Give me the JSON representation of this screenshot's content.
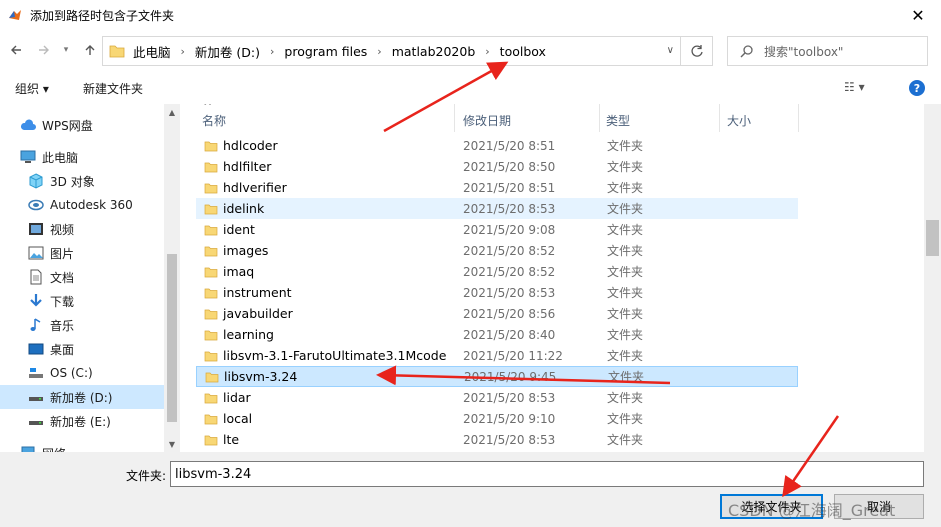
{
  "window": {
    "title": "添加到路径时包含子文件夹",
    "close": "✕"
  },
  "nav": {
    "breadcrumbs": [
      "此电脑",
      "新加卷 (D:)",
      "program files",
      "matlab2020b",
      "toolbox"
    ],
    "search_placeholder": "搜索\"toolbox\""
  },
  "toolbar": {
    "organize": "组织 ▾",
    "new_folder": "新建文件夹",
    "view": "☷ ▾",
    "help": "?"
  },
  "sidebar": {
    "items": [
      {
        "label": "WPS网盘",
        "icon": "cloud-icon"
      },
      {
        "label": "此电脑",
        "icon": "computer-icon"
      },
      {
        "label": "3D 对象",
        "icon": "3d-objects-icon"
      },
      {
        "label": "Autodesk 360",
        "icon": "autodesk-icon"
      },
      {
        "label": "视频",
        "icon": "video-icon"
      },
      {
        "label": "图片",
        "icon": "pictures-icon"
      },
      {
        "label": "文档",
        "icon": "documents-icon"
      },
      {
        "label": "下载",
        "icon": "download-icon"
      },
      {
        "label": "音乐",
        "icon": "music-icon"
      },
      {
        "label": "桌面",
        "icon": "desktop-icon"
      },
      {
        "label": "OS (C:)",
        "icon": "drive-icon"
      },
      {
        "label": "新加卷 (D:)",
        "icon": "drive-icon",
        "selected": true
      },
      {
        "label": "新加卷 (E:)",
        "icon": "drive-icon"
      },
      {
        "label": "网络",
        "icon": "network-icon"
      }
    ]
  },
  "columns": {
    "name": "名称",
    "date": "修改日期",
    "type": "类型",
    "size": "大小"
  },
  "files": [
    {
      "name": "hdlcoder",
      "date": "2021/5/20 8:51",
      "type": "文件夹"
    },
    {
      "name": "hdlfilter",
      "date": "2021/5/20 8:50",
      "type": "文件夹"
    },
    {
      "name": "hdlverifier",
      "date": "2021/5/20 8:51",
      "type": "文件夹"
    },
    {
      "name": "idelink",
      "date": "2021/5/20 8:53",
      "type": "文件夹",
      "state": "hover"
    },
    {
      "name": "ident",
      "date": "2021/5/20 9:08",
      "type": "文件夹"
    },
    {
      "name": "images",
      "date": "2021/5/20 8:52",
      "type": "文件夹"
    },
    {
      "name": "imaq",
      "date": "2021/5/20 8:52",
      "type": "文件夹"
    },
    {
      "name": "instrument",
      "date": "2021/5/20 8:53",
      "type": "文件夹"
    },
    {
      "name": "javabuilder",
      "date": "2021/5/20 8:56",
      "type": "文件夹"
    },
    {
      "name": "learning",
      "date": "2021/5/20 8:40",
      "type": "文件夹"
    },
    {
      "name": "libsvm-3.1-FarutoUltimate3.1Mcode",
      "date": "2021/5/20 11:22",
      "type": "文件夹"
    },
    {
      "name": "libsvm-3.24",
      "date": "2021/5/20 9:45",
      "type": "文件夹",
      "state": "selected"
    },
    {
      "name": "lidar",
      "date": "2021/5/20 8:53",
      "type": "文件夹"
    },
    {
      "name": "local",
      "date": "2021/5/20 9:10",
      "type": "文件夹"
    },
    {
      "name": "lte",
      "date": "2021/5/20 8:53",
      "type": "文件夹"
    }
  ],
  "bottom": {
    "folder_label": "文件夹:",
    "folder_value": "libsvm-3.24",
    "select_button": "选择文件夹",
    "cancel_button": "取消"
  },
  "watermark": "CSDN @江海阔_Great",
  "colors": {
    "accent": "#0078d7",
    "arrow": "#e8241c",
    "folder": "#f8d775",
    "selected_row": "#cce8ff"
  }
}
